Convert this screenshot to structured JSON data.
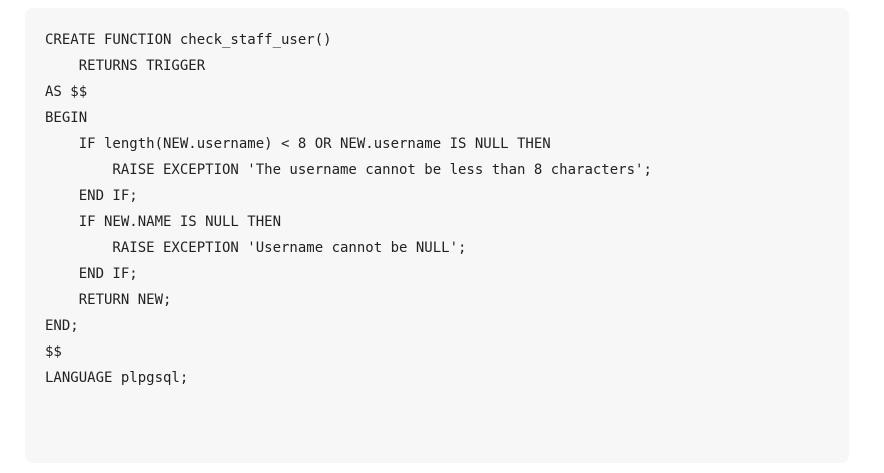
{
  "code": {
    "language": "sql",
    "lines": [
      "CREATE FUNCTION check_staff_user()",
      "    RETURNS TRIGGER",
      "AS $$",
      "BEGIN",
      "    IF length(NEW.username) < 8 OR NEW.username IS NULL THEN",
      "        RAISE EXCEPTION 'The username cannot be less than 8 characters';",
      "    END IF;",
      "    IF NEW.NAME IS NULL THEN",
      "        RAISE EXCEPTION 'Username cannot be NULL';",
      "    END IF;",
      "    RETURN NEW;",
      "END;",
      "$$",
      "LANGUAGE plpgsql;"
    ]
  },
  "colors": {
    "code_background": "#f7f7f7",
    "code_text": "#222222",
    "page_background": "#ffffff"
  }
}
